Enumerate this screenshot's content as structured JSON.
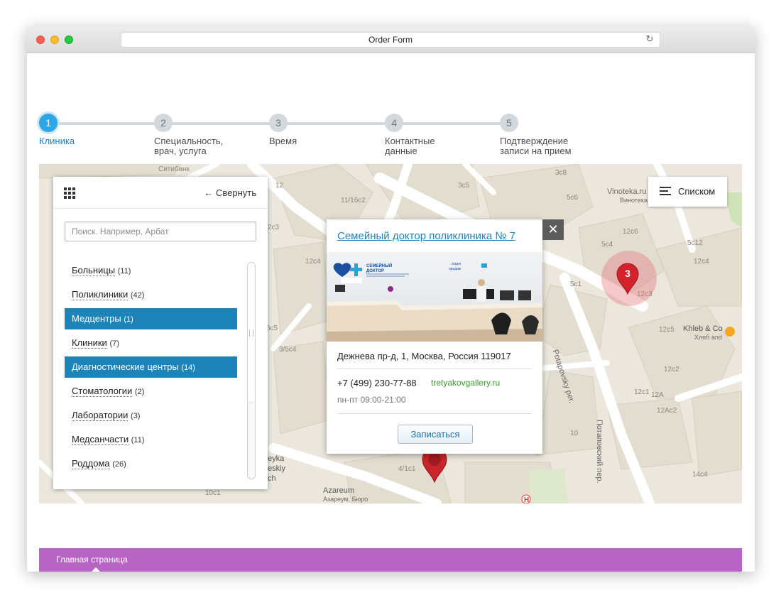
{
  "window": {
    "title": "Order Form"
  },
  "steps": [
    {
      "num": "1",
      "label": "Клиника"
    },
    {
      "num": "2",
      "label": "Специальность, врач, услуга"
    },
    {
      "num": "3",
      "label": "Время"
    },
    {
      "num": "4",
      "label": "Контактные данные"
    },
    {
      "num": "5",
      "label": "Подтверждение записи на прием"
    }
  ],
  "active_step": 1,
  "panel": {
    "collapse_label": "← Свернуть",
    "search_placeholder": "Поиск. Например, Арбат",
    "categories": [
      {
        "name": "Больницы",
        "count": "(11)",
        "selected": false
      },
      {
        "name": "Поликлиники",
        "count": "(42)",
        "selected": false
      },
      {
        "name": "Медцентры",
        "count": "(1)",
        "selected": true
      },
      {
        "name": "Клиники",
        "count": "(7)",
        "selected": false
      },
      {
        "name": "Диагностические центры",
        "count": "(14)",
        "selected": true
      },
      {
        "name": "Стоматологии",
        "count": "(2)",
        "selected": false
      },
      {
        "name": "Лаборатории",
        "count": "(3)",
        "selected": false
      },
      {
        "name": "Медсанчасти",
        "count": "(11)",
        "selected": false
      },
      {
        "name": "Роддома",
        "count": "(26)",
        "selected": false
      }
    ]
  },
  "list_button": {
    "label": "Списком"
  },
  "popup": {
    "title": "Семейный доктор поликлиника № 7",
    "close": "✕",
    "photo_sign": {
      "brand_line1": "СЕМЕЙНЫЙ",
      "brand_line2": "ДОКТОР",
      "dept_line1": "отдел",
      "dept_line2": "продаж"
    },
    "address": "Дежнева пр-д, 1, Москва, Россия 119017",
    "phone": "+7 (499) 230-77-88",
    "site": "tretyakovgallery.ru",
    "hours": "пн-пт 09:00-21:00",
    "book_button": "Записаться"
  },
  "cluster": {
    "count": "3"
  },
  "map_labels": [
    "Ситибанк",
    "12",
    "11/16c2",
    "3c5",
    "3c8",
    "5c6",
    "5c4",
    "12c6",
    "12c4",
    "12c3",
    "5c12",
    "Vinoteka.ru",
    "Винотека",
    "2c3",
    "12c4",
    "5c1",
    "12c5",
    "Khleb & Co",
    "Хлеб and",
    "5c5",
    "3/5c4",
    "12c2",
    "12c1",
    "12A",
    "12Ac2",
    "10",
    "14c4",
    "4/1c1",
    "Azareum",
    "Азареум, Бюро",
    "10c1",
    "Potapovsky per.",
    "Потаповский пер.",
    "eyka",
    "eskiy",
    "ch"
  ],
  "footer": {
    "link": "Главная страница"
  },
  "colors": {
    "accent": "#1c84b8",
    "footer": "#b764c5",
    "active_step": "#2ea5e4",
    "site_link": "#3b9b2e"
  }
}
